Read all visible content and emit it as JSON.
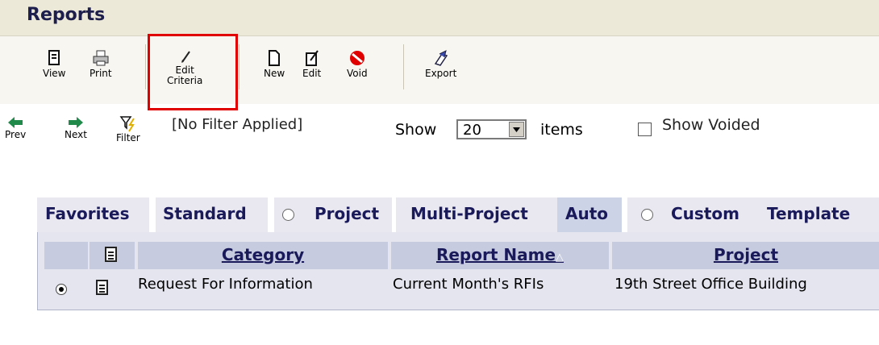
{
  "header": {
    "title": "Reports"
  },
  "toolbar": {
    "view": "View",
    "print": "Print",
    "edit_criteria_line1": "Edit",
    "edit_criteria_line2": "Criteria",
    "new": "New",
    "edit": "Edit",
    "void": "Void",
    "export": "Export"
  },
  "nav": {
    "prev": "Prev",
    "next": "Next",
    "filter": "Filter",
    "filter_status": "[No Filter Applied]"
  },
  "paging": {
    "show_label": "Show",
    "show_value": "20",
    "items_label": "items",
    "show_voided_label": "Show Voided"
  },
  "tabs": [
    {
      "label": "Favorites"
    },
    {
      "label": "Standard"
    },
    {
      "label": "Project"
    },
    {
      "label": "Multi-Project"
    },
    {
      "label": "Auto"
    },
    {
      "label": "Custom"
    },
    {
      "label": "Template"
    }
  ],
  "table": {
    "columns": [
      "Category",
      "Report Name",
      "Project"
    ],
    "sort_indicator": "△",
    "rows": [
      {
        "category": "Request For Information",
        "report_name": "Current Month's RFIs",
        "project": "19th Street Office Building"
      }
    ]
  }
}
